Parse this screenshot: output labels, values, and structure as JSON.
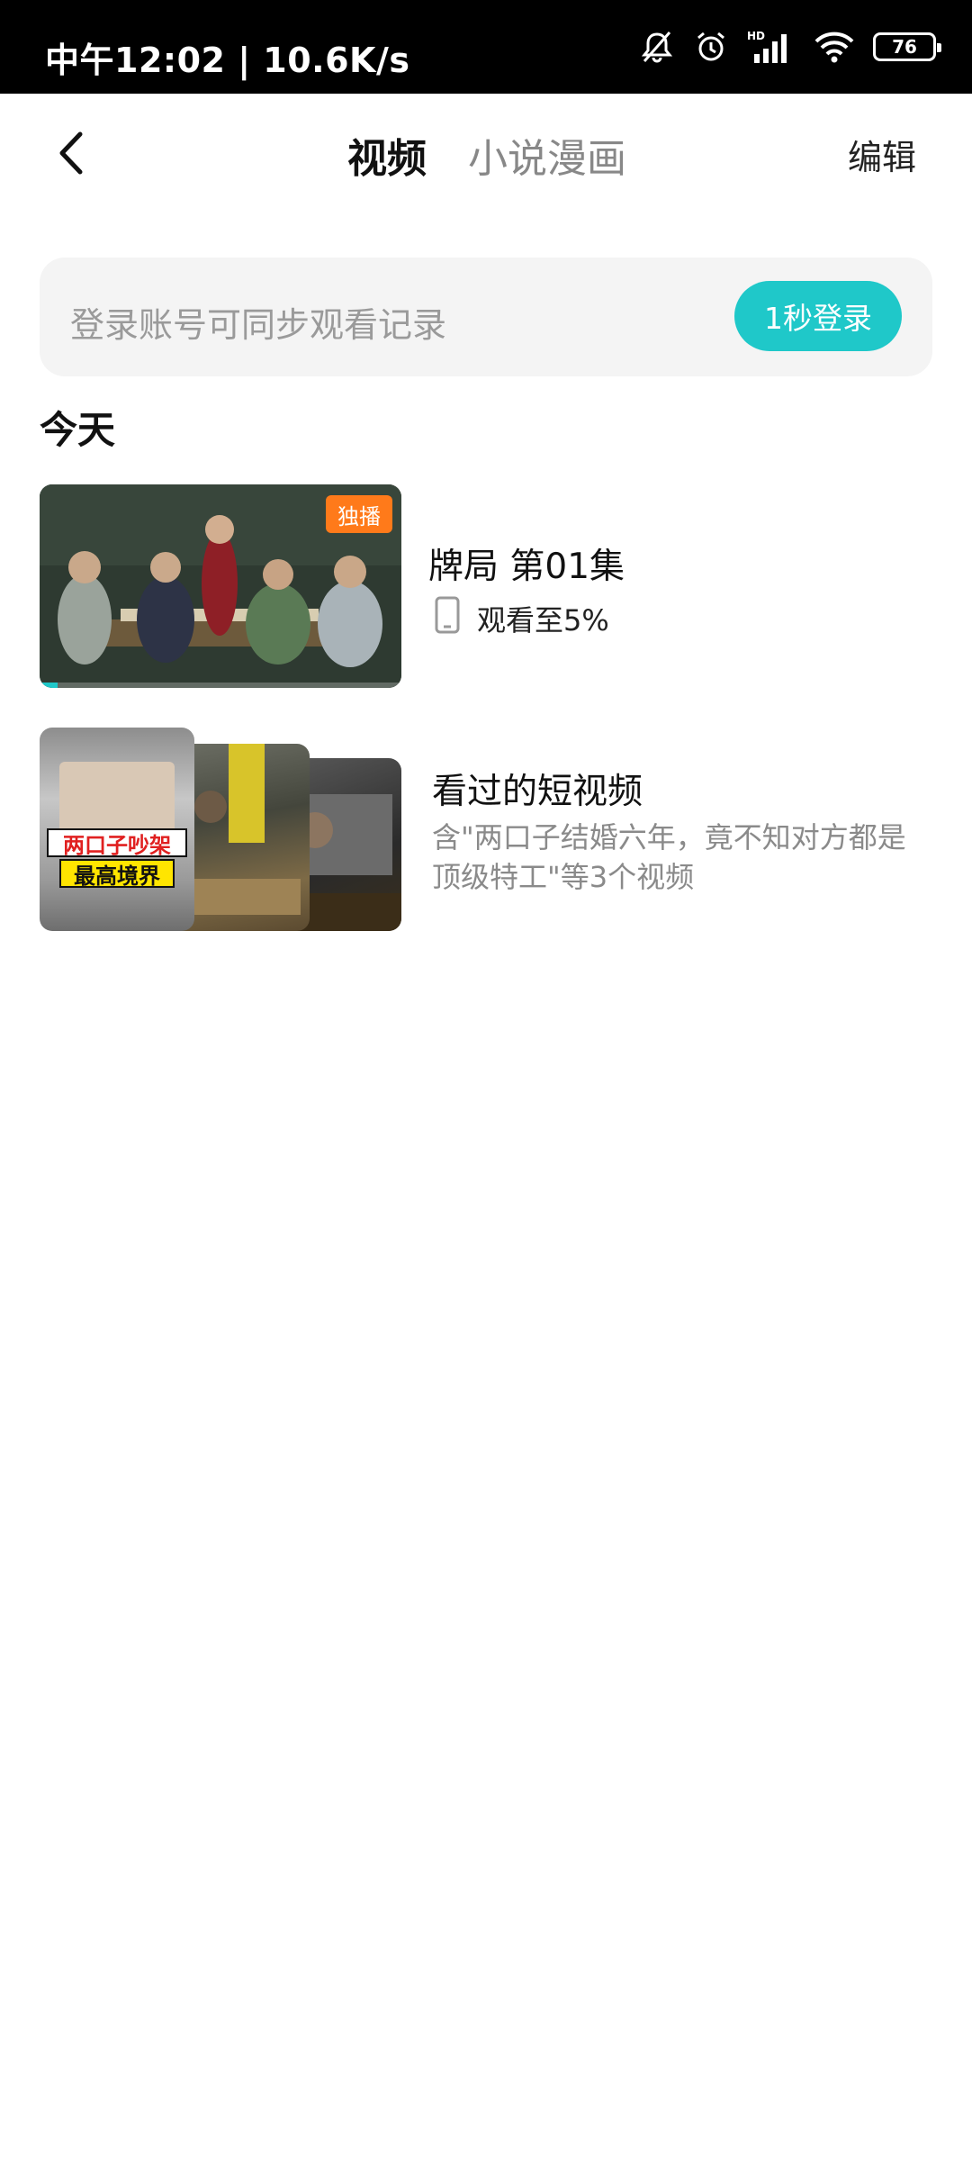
{
  "status_bar": {
    "left_text": "中午12:02 | 10.6K/s",
    "signal_label": "HD",
    "battery": "76"
  },
  "header": {
    "tabs": [
      {
        "label": "视频",
        "active": true
      },
      {
        "label": "小说漫画",
        "active": false
      }
    ],
    "edit_label": "编辑"
  },
  "login_banner": {
    "text": "登录账号可同步观看记录",
    "button_label": "1秒登录"
  },
  "section": {
    "title": "今天"
  },
  "history": [
    {
      "title": "牌局 第01集",
      "badge": "独播",
      "progress_text": "观看至5%",
      "progress_percent": 5
    },
    {
      "title": "看过的短视频",
      "description": "含\"两口子结婚六年，竟不知对方都是顶级特工\"等3个视频",
      "cover_text_line1": "两口子吵架",
      "cover_text_line2": "最高境界"
    }
  ],
  "colors": {
    "accent": "#1fc8c9",
    "badge": "#ff7a1a"
  },
  "icons": [
    "back-arrow-icon",
    "mute-bell-icon",
    "alarm-icon",
    "signal-icon",
    "wifi-icon",
    "battery-icon",
    "phone-device-icon"
  ]
}
